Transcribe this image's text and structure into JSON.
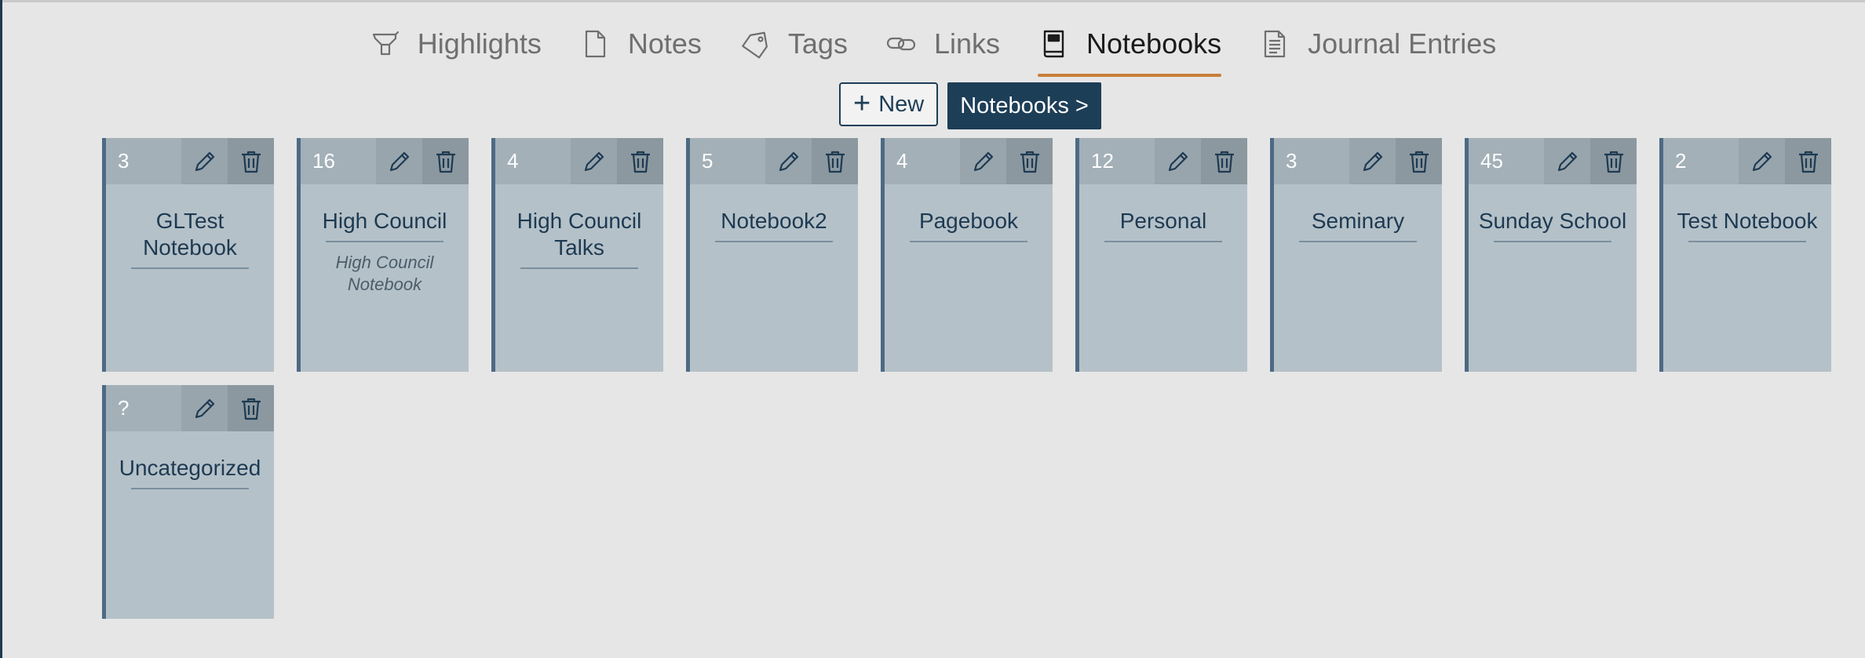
{
  "tabs": [
    {
      "label": "Highlights",
      "icon": "highlighter-icon"
    },
    {
      "label": "Notes",
      "icon": "note-icon"
    },
    {
      "label": "Tags",
      "icon": "tag-icon"
    },
    {
      "label": "Links",
      "icon": "link-icon"
    },
    {
      "label": "Notebooks",
      "icon": "notebook-icon",
      "active": true
    },
    {
      "label": "Journal Entries",
      "icon": "journal-icon"
    }
  ],
  "actions": {
    "new_label": "New",
    "notebooks_label": "Notebooks >"
  },
  "notebooks": [
    {
      "count": "3",
      "title": "GLTest Notebook",
      "subtitle": ""
    },
    {
      "count": "16",
      "title": "High Council",
      "subtitle": "High Council Notebook"
    },
    {
      "count": "4",
      "title": "High Council Talks",
      "subtitle": ""
    },
    {
      "count": "5",
      "title": "Notebook2",
      "subtitle": ""
    },
    {
      "count": "4",
      "title": "Pagebook",
      "subtitle": ""
    },
    {
      "count": "12",
      "title": "Personal",
      "subtitle": ""
    },
    {
      "count": "3",
      "title": "Seminary",
      "subtitle": ""
    },
    {
      "count": "45",
      "title": "Sunday School",
      "subtitle": ""
    },
    {
      "count": "2",
      "title": "Test Notebook",
      "subtitle": ""
    },
    {
      "count": "?",
      "title": "Uncategorized",
      "subtitle": ""
    }
  ],
  "colors": {
    "accent": "#c87f3a",
    "primary": "#1d3e57",
    "card": "#b5c1c8"
  }
}
